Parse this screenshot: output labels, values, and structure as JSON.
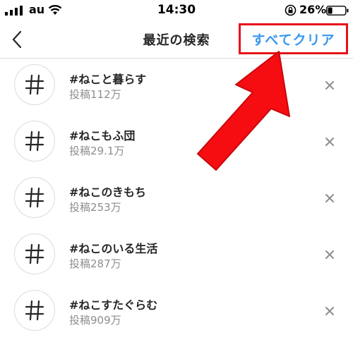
{
  "status_bar": {
    "carrier": "au",
    "time": "14:30",
    "battery": "26%",
    "battery_level": 0.26
  },
  "nav": {
    "title": "最近の検索",
    "clear_all_label": "すべてクリア"
  },
  "results": [
    {
      "name": "#ねこと暮らす",
      "count": "投稿112万"
    },
    {
      "name": "#ねこもふ団",
      "count": "投稿29.1万"
    },
    {
      "name": "#ねこのきもち",
      "count": "投稿253万"
    },
    {
      "name": "#ねこのいる生活",
      "count": "投稿287万"
    },
    {
      "name": "#ねこすたぐらむ",
      "count": "投稿909万"
    }
  ],
  "colors": {
    "link_blue": "#3897f0",
    "highlight_red": "#e8101a",
    "secondary_text": "#8e8e8e",
    "divider": "#dbdbdb"
  },
  "icons": {
    "back": "chevron-left-icon",
    "hashtag": "hashtag-icon",
    "remove": "close-icon"
  }
}
